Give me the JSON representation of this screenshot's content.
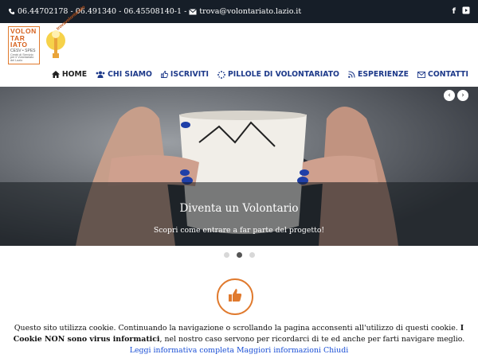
{
  "topbar": {
    "contact_text": "06.44702178 - 06.491340 - 06.45508140-1 -",
    "email": "trova@volontariato.lazio.it",
    "social": [
      {
        "icon": "facebook-icon",
        "glyph": "f"
      },
      {
        "icon": "youtube-icon",
        "glyph": "▶"
      }
    ]
  },
  "logos": {
    "left": {
      "line1a": "VOLO",
      "line1b": "N",
      "line2a": "TAR",
      "line2b": "IATO",
      "tag": "CESV • SPES",
      "sub": "Centri di Servizio per il Volontariato del Lazio"
    },
    "right": {
      "text": "trovavolontariato"
    }
  },
  "nav": {
    "items": [
      {
        "label": "HOME",
        "icon": "home-icon"
      },
      {
        "label": "CHI SIAMO",
        "icon": "users-icon"
      },
      {
        "label": "ISCRIVITI",
        "icon": "thumbs-up-icon"
      },
      {
        "label": "PILLOLE DI VOLONTARIATO",
        "icon": "spinner-icon"
      },
      {
        "label": "ESPERIENZE",
        "icon": "rss-icon"
      },
      {
        "label": "CONTATTI",
        "icon": "envelope-icon"
      }
    ]
  },
  "hero": {
    "title": "Diventa un Volontario",
    "subtitle": "Scopri come entrare a far parte del progetto!",
    "prev_glyph": "‹",
    "next_glyph": "›",
    "slides_count": 3,
    "active_slide": 2
  },
  "cookie": {
    "text1": "Questo sito utilizza cookie. Continuando la navigazione o scrollando la pagina acconsenti all'utilizzo di questi cookie.",
    "bold": "I Cookie NON sono virus informatici",
    "text2": ", nel nostro caso servono per ricordarci di te ed anche per farti navigare meglio.",
    "link1": "Leggi informativa completa",
    "link2": "Maggiori informazioni",
    "link3": "Chiudi"
  },
  "colors": {
    "topbar_bg": "#161e28",
    "nav_text": "#1e3a8a",
    "accent_orange": "#e07a2e",
    "link_blue": "#1a4fd6"
  }
}
